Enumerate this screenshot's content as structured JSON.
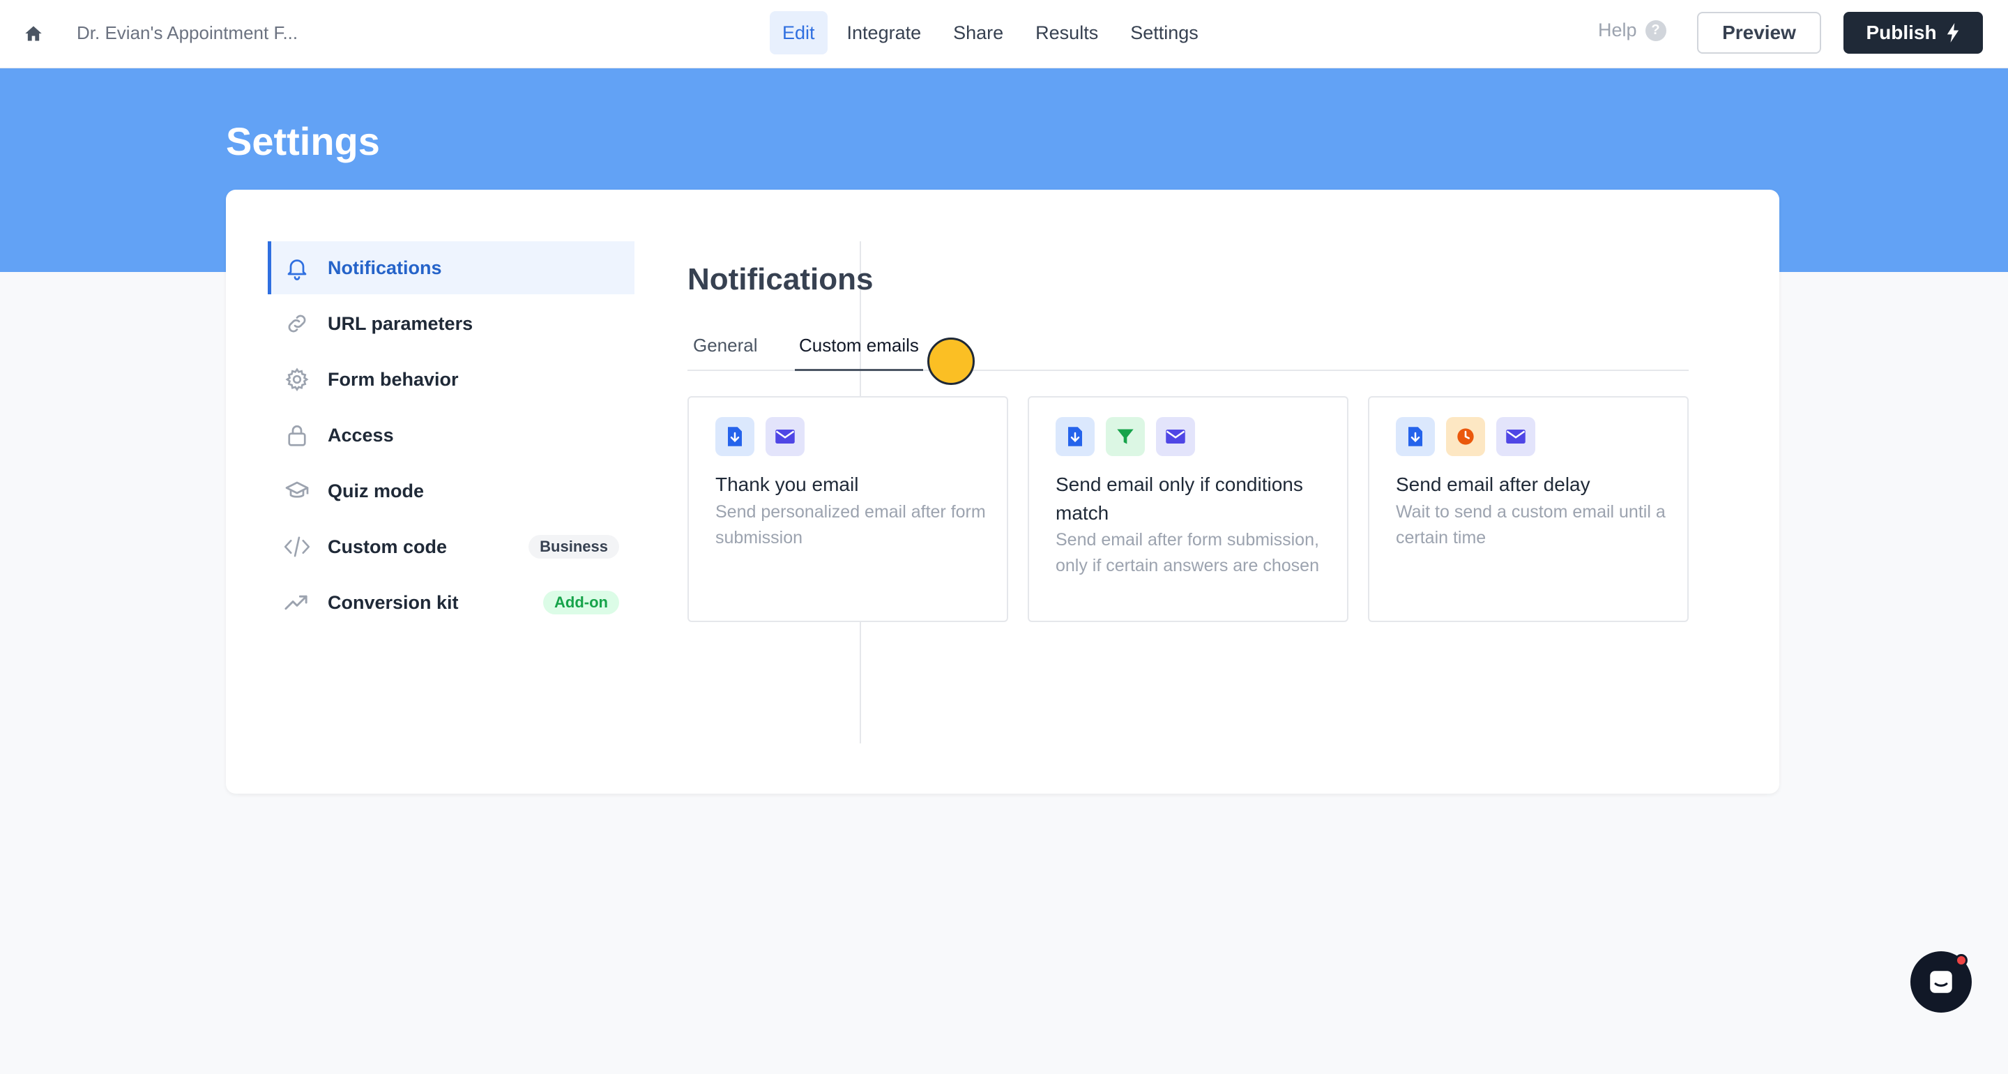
{
  "topbar": {
    "home_icon": "home-icon",
    "form_title": "Dr. Evian's Appointment F...",
    "nav": [
      {
        "label": "Edit",
        "active": true
      },
      {
        "label": "Integrate",
        "active": false
      },
      {
        "label": "Share",
        "active": false
      },
      {
        "label": "Results",
        "active": false
      },
      {
        "label": "Settings",
        "active": false
      }
    ],
    "help_label": "Help",
    "help_icon_glyph": "?",
    "preview_label": "Preview",
    "publish_label": "Publish",
    "publish_icon": "lightning-icon"
  },
  "page": {
    "title": "Settings",
    "hero_color": "#62a2f5",
    "accent_color": "#2f6fe0"
  },
  "sidebar": {
    "items": [
      {
        "label": "Notifications",
        "icon": "bell-icon",
        "active": true
      },
      {
        "label": "URL parameters",
        "icon": "link-icon",
        "active": false
      },
      {
        "label": "Form behavior",
        "icon": "gear-icon",
        "active": false
      },
      {
        "label": "Access",
        "icon": "lock-icon",
        "active": false
      },
      {
        "label": "Quiz mode",
        "icon": "graduation-cap-icon",
        "active": false
      },
      {
        "label": "Custom code",
        "icon": "code-icon",
        "active": false,
        "badge": "Business"
      },
      {
        "label": "Conversion kit",
        "icon": "trending-up-icon",
        "active": false,
        "badge": "Add-on"
      }
    ]
  },
  "content": {
    "title": "Notifications",
    "tabs": [
      {
        "label": "General",
        "active": false
      },
      {
        "label": "Custom emails",
        "active": true
      }
    ],
    "cards": [
      {
        "title": "Thank you email",
        "description": "Send personalized email after form submission",
        "icons": [
          "form-submit-icon",
          "envelope-icon"
        ]
      },
      {
        "title": "Send email only if conditions match",
        "description": "Send email after form submission, only if certain answers are chosen",
        "icons": [
          "form-submit-icon",
          "filter-icon",
          "envelope-icon"
        ]
      },
      {
        "title": "Send email after delay",
        "description": "Wait to send a custom email until a certain time",
        "icons": [
          "form-submit-icon",
          "clock-icon",
          "envelope-icon"
        ]
      }
    ]
  },
  "chat": {
    "icon": "chat-icon",
    "has_notification": true
  }
}
